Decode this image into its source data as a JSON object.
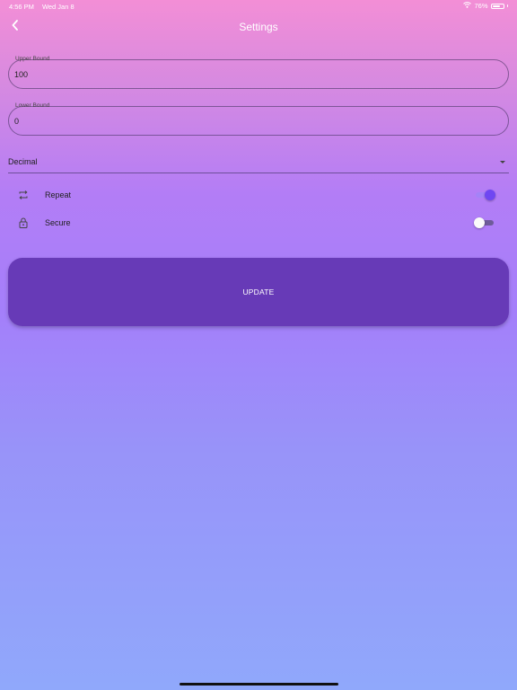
{
  "status_bar": {
    "time": "4:56 PM",
    "date": "Wed Jan 8",
    "battery": "76%",
    "battery_level": 0.76,
    "wifi_icon": "wifi-icon"
  },
  "header": {
    "title": "Settings",
    "back_icon": "chevron-left-icon"
  },
  "fields": {
    "upper_bound": {
      "label": "Upper Bound",
      "value": "100"
    },
    "lower_bound": {
      "label": "Lower Bound",
      "value": "0"
    }
  },
  "dropdown": {
    "selected": "Decimal",
    "icon": "caret-down-icon"
  },
  "toggles": [
    {
      "label": "Repeat",
      "icon": "repeat-icon",
      "on": true
    },
    {
      "label": "Secure",
      "icon": "lock-icon",
      "on": false
    }
  ],
  "actions": {
    "update_label": "UPDATE"
  },
  "colors": {
    "gradient_top": "#f38ed6",
    "gradient_middle": "#a47ffa",
    "gradient_bottom": "#90a8fb",
    "button": "#673ab7",
    "switch_on": "#6f47f2"
  }
}
